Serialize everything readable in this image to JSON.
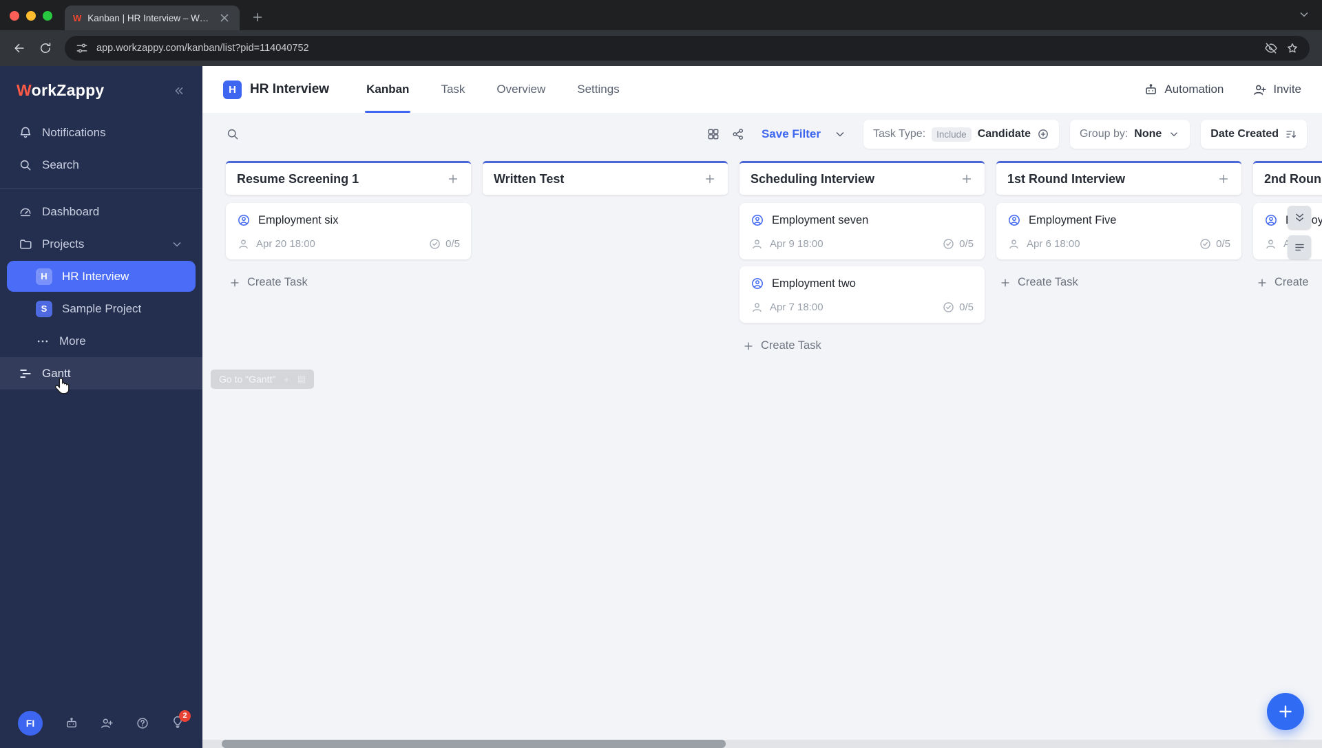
{
  "colors": {
    "accent": "#3e66f0",
    "sidebar_bg": "#242e4e",
    "active_item": "#4a6cf7",
    "column_accent": "#4c67d6",
    "fab": "#2f6bf3",
    "notification_badge": "#e94235"
  },
  "browser": {
    "tab_title": "Kanban | HR Interview – Work",
    "url": "app.workzappy.com/kanban/list?pid=114040752"
  },
  "sidebar": {
    "logo_w": "W",
    "logo_rest": "orkZappy",
    "notifications": "Notifications",
    "search": "Search",
    "dashboard": "Dashboard",
    "projects": "Projects",
    "project_items": [
      {
        "badge": "H",
        "label": "HR Interview"
      },
      {
        "badge": "S",
        "label": "Sample Project"
      }
    ],
    "more": "More",
    "gantt": "Gantt",
    "gantt_tooltip": "Go to \"Gantt\"",
    "avatar_initials": "FI",
    "notification_count": "2"
  },
  "header": {
    "project_badge": "H",
    "title": "HR Interview",
    "tabs": [
      "Kanban",
      "Task",
      "Overview",
      "Settings"
    ],
    "active_tab": "Kanban",
    "automation_label": "Automation",
    "invite_label": "Invite"
  },
  "toolbar": {
    "save_filter_label": "Save Filter",
    "task_type_label": "Task Type:",
    "task_type_mode": "Include",
    "task_type_value": "Candidate",
    "group_by_label": "Group by:",
    "group_by_value": "None",
    "sort_label": "Date Created"
  },
  "board": {
    "columns": [
      {
        "title": "Resume Screening 1",
        "create_label": "Create Task",
        "cards": [
          {
            "title": "Employment six",
            "date": "Apr 20 18:00",
            "checklist": "0/5"
          }
        ]
      },
      {
        "title": "Written Test",
        "cards": []
      },
      {
        "title": "Scheduling Interview",
        "create_label": "Create Task",
        "cards": [
          {
            "title": "Employment seven",
            "date": "Apr 9 18:00",
            "checklist": "0/5"
          },
          {
            "title": "Employment two",
            "date": "Apr 7 18:00",
            "checklist": "0/5"
          }
        ]
      },
      {
        "title": "1st Round Interview",
        "create_label": "Create Task",
        "cards": [
          {
            "title": "Employment Five",
            "date": "Apr 6 18:00",
            "checklist": "0/5"
          }
        ]
      },
      {
        "title": "2nd Roun",
        "create_label": "Create",
        "cards": [
          {
            "title": "Employ",
            "date": "Apr",
            "checklist": ""
          }
        ]
      }
    ]
  }
}
